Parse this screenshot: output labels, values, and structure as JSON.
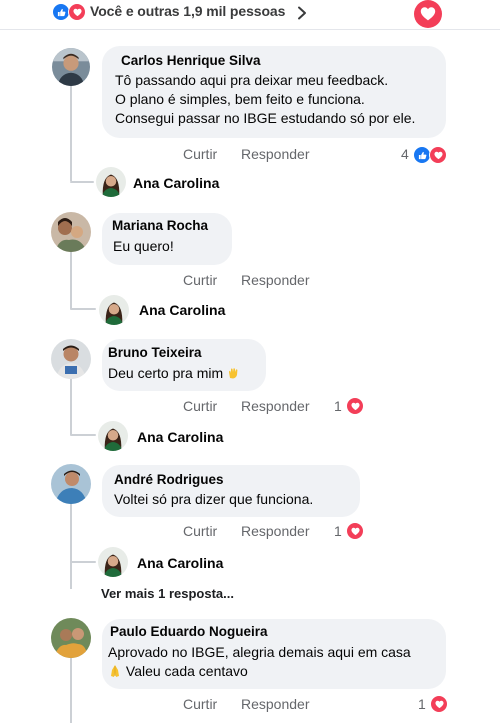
{
  "header": {
    "reactions_text": "Você e outras 1,9 mil pessoas"
  },
  "actions": {
    "like": "Curtir",
    "reply": "Responder"
  },
  "reply_author": "Ana Carolina",
  "comments": [
    {
      "name": "Carlos Henrique Silva",
      "lines": [
        "Tô passando aqui pra deixar meu feedback.",
        "O plano é simples, bem feito e funciona.",
        "Consegui passar no IBGE estudando só por ele."
      ],
      "reaction_count": "4"
    },
    {
      "name": "Mariana Rocha",
      "lines": [
        "Eu quero!"
      ],
      "reaction_count": ""
    },
    {
      "name": "Bruno Teixeira",
      "lines": [
        "Deu certo pra mim"
      ],
      "reaction_count": "1"
    },
    {
      "name": "André Rodrigues",
      "lines": [
        "Voltei só pra dizer que funciona."
      ],
      "reaction_count": "1"
    },
    {
      "name": "Paulo Eduardo Nogueira",
      "lines": [
        "Aprovado no IBGE, alegria demais aqui em casa",
        "Valeu cada centavo"
      ],
      "reaction_count": "1"
    }
  ],
  "more_replies": "Ver mais 1 resposta...",
  "icons": {
    "like": "thumbs-up-icon",
    "love": "heart-icon",
    "chevron": "chevron-right-icon",
    "clap": "clap-emoji",
    "pray": "pray-emoji"
  },
  "colors": {
    "like": "#1877f2",
    "love": "#f33e58",
    "bubble": "#f0f2f5",
    "action": "#65676b"
  }
}
